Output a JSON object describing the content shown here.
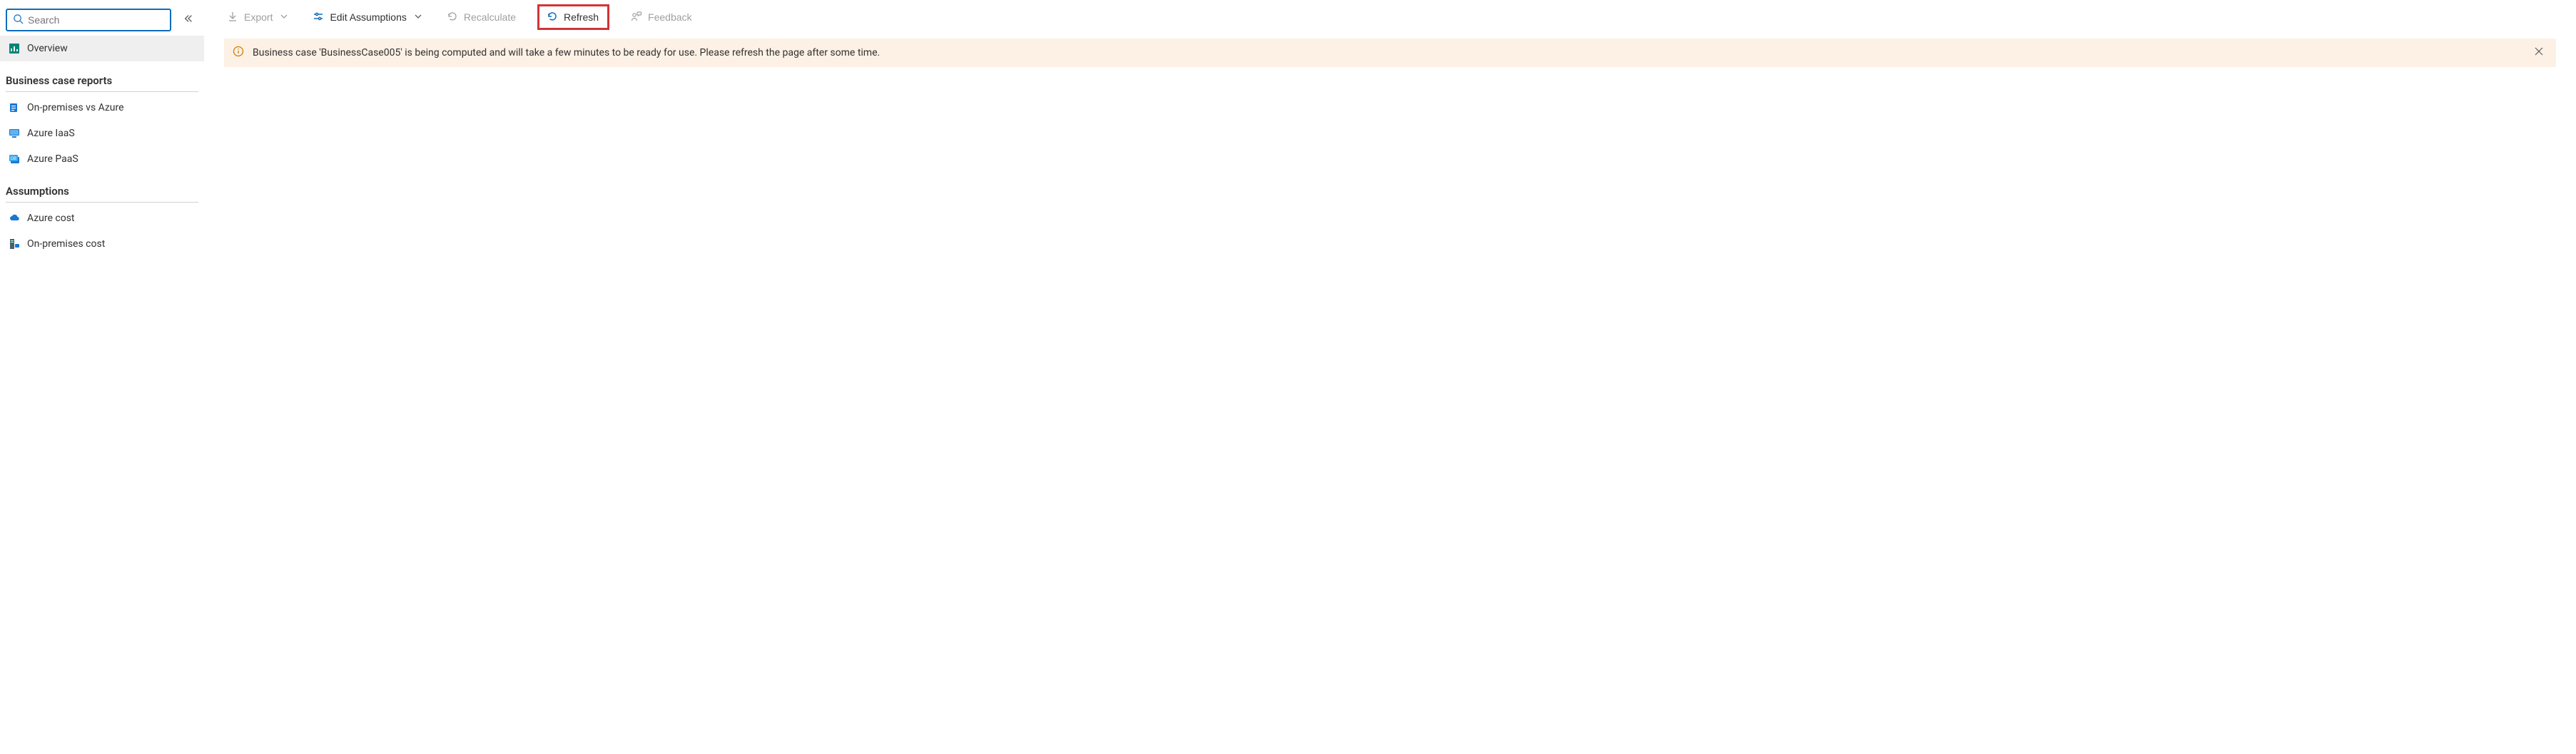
{
  "search": {
    "placeholder": "Search"
  },
  "sidebar": {
    "overview_label": "Overview",
    "section_reports": "Business case reports",
    "reports": {
      "onprem_vs_azure": "On-premises vs Azure",
      "azure_iaas": "Azure IaaS",
      "azure_paas": "Azure PaaS"
    },
    "section_assumptions": "Assumptions",
    "assumptions": {
      "azure_cost": "Azure cost",
      "onprem_cost": "On-premises cost"
    }
  },
  "toolbar": {
    "export_label": "Export",
    "edit_assumptions_label": "Edit Assumptions",
    "recalculate_label": "Recalculate",
    "refresh_label": "Refresh",
    "feedback_label": "Feedback"
  },
  "notice": {
    "message": "Business case 'BusinessCase005' is being computed and will take a few minutes to be ready for use. Please refresh the page after some time."
  },
  "colors": {
    "accent": "#0f6cbd",
    "highlight_border": "#d13438",
    "notice_bg": "#fdf1e6",
    "teal": "#008575"
  }
}
